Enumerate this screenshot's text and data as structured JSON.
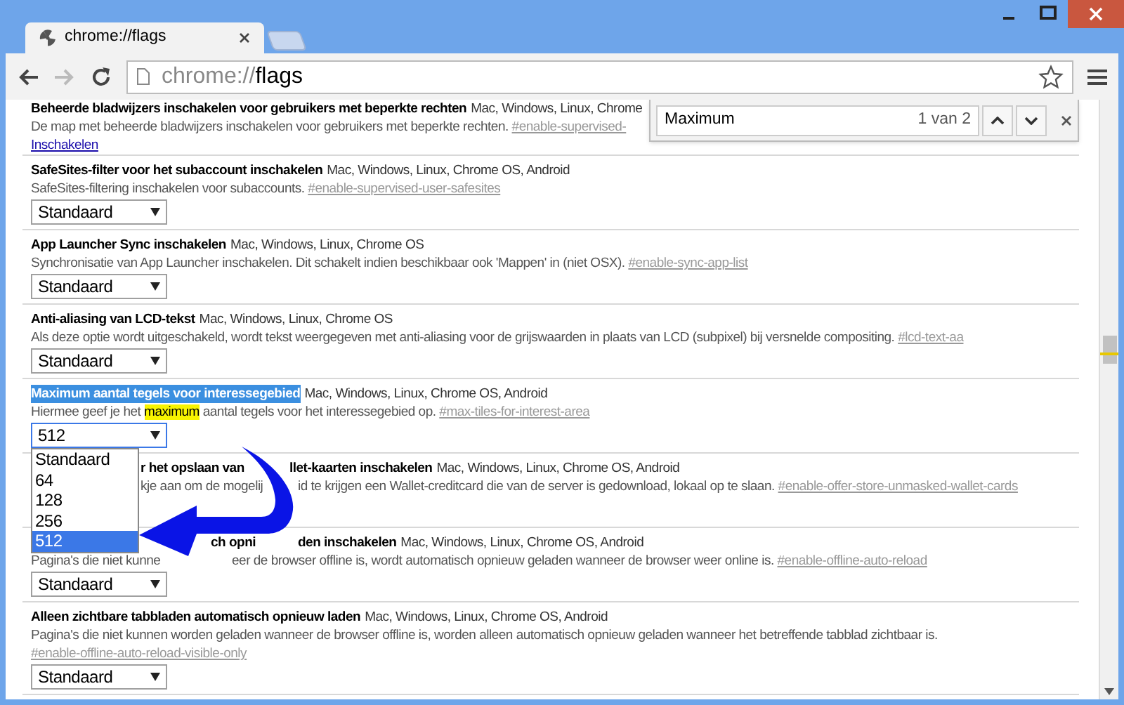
{
  "tab": {
    "title": "chrome://flags",
    "selected": true
  },
  "omnibox": {
    "scheme": "chrome://",
    "host": "flags"
  },
  "find_bar": {
    "value": "Maximum",
    "count": "1 van 2"
  },
  "experiments": [
    {
      "title": [
        "Beheerde bladwijzers inschakelen voor gebruikers met beperkte rechten"
      ],
      "highlighted": false,
      "platforms": "Mac, Windows, Linux, Chrome",
      "description": [
        {
          "text": "De map met beheerde bladwijzers inschakelen voor gebruikers met beperkte rechten.",
          "highlight": false
        }
      ],
      "flag": "#enable-supervised-",
      "control": {
        "kind": "link",
        "label": "Inschakelen"
      }
    },
    {
      "title": [
        "SafeSites-filter voor het subaccount inschakelen"
      ],
      "highlighted": false,
      "platforms": "Mac, Windows, Linux, Chrome OS, Android",
      "description": [
        {
          "text": "SafeSites-filtering inschakelen voor subaccounts.",
          "highlight": false
        }
      ],
      "flag": "#enable-supervised-user-safesites",
      "control": {
        "kind": "select",
        "value": "Standaard"
      }
    },
    {
      "title": [
        "App Launcher Sync inschakelen"
      ],
      "highlighted": false,
      "platforms": "Mac, Windows, Linux, Chrome OS",
      "description": [
        {
          "text": "Synchronisatie van App Launcher inschakelen. Dit schakelt indien beschikbaar ook 'Mappen' in (niet OSX).",
          "highlight": false
        }
      ],
      "flag": "#enable-sync-app-list",
      "control": {
        "kind": "select",
        "value": "Standaard"
      }
    },
    {
      "title": [
        "Anti-aliasing van LCD-tekst"
      ],
      "highlighted": false,
      "platforms": "Mac, Windows, Linux, Chrome OS",
      "description": [
        {
          "text": "Als deze optie wordt uitgeschakeld, wordt tekst weergegeven met anti-aliasing voor de grijswaarden in plaats van LCD (subpixel) bij versnelde compositing.",
          "highlight": false
        }
      ],
      "flag": "#lcd-text-aa",
      "control": {
        "kind": "select",
        "value": "Standaard"
      }
    },
    {
      "title": [
        "Maximum aantal tegels voor interessegebied"
      ],
      "highlighted": true,
      "platforms": "Mac, Windows, Linux, Chrome OS, Android",
      "description": [
        {
          "text": "Hiermee geef je het ",
          "highlight": false
        },
        {
          "text": "maximum",
          "highlight": true
        },
        {
          "text": " aantal tegels voor het interessegebied op.",
          "highlight": false
        }
      ],
      "flag": "#max-tiles-for-interest-area",
      "control": {
        "kind": "select",
        "value": "512",
        "open": true,
        "options": [
          {
            "label": "Standaard",
            "selected": false
          },
          {
            "label": "64",
            "selected": false
          },
          {
            "label": "128",
            "selected": false
          },
          {
            "label": "256",
            "selected": false
          },
          {
            "label": "512",
            "selected": true
          }
        ]
      }
    },
    {
      "title": [
        "r het opslaan van",
        "llet-kaarten inschakelen"
      ],
      "highlighted": false,
      "platforms": "Mac, Windows, Linux, Chrome OS, Android",
      "description": [
        {
          "text": "kje aan om de mogelij",
          "highlight": false
        },
        {
          "text": "id te krijgen een Wallet-creditcard die van de server is gedownload, lokaal op te slaan.",
          "highlight": false
        }
      ],
      "flag": "#enable-offer-store-unmasked-wallet-cards",
      "control": {
        "kind": "hidden"
      }
    },
    {
      "title": [
        "ch opni",
        "den inschakelen"
      ],
      "highlighted": false,
      "platforms": "Mac, Windows, Linux, Chrome OS, Android",
      "description": [
        {
          "text": "Pagina's die niet kunne",
          "highlight": false
        },
        {
          "text": "eer de browser offline is, wordt automatisch opnieuw geladen wanneer de browser weer online is.",
          "highlight": false
        }
      ],
      "flag": "#enable-offline-auto-reload",
      "control": {
        "kind": "select",
        "value": "Standaard"
      }
    },
    {
      "title": [
        "Alleen zichtbare tabbladen automatisch opnieuw laden"
      ],
      "highlighted": false,
      "platforms": "Mac, Windows, Linux, Chrome OS, Android",
      "description": [
        {
          "text": "Pagina's die niet kunnen worden geladen wanneer de browser offline is, worden alleen automatisch opnieuw geladen wanneer het betreffende tabblad zichtbaar is.",
          "highlight": false
        }
      ],
      "flag": "#enable-offline-auto-reload-visible-only",
      "control": {
        "kind": "select",
        "value": "Standaard"
      }
    }
  ]
}
